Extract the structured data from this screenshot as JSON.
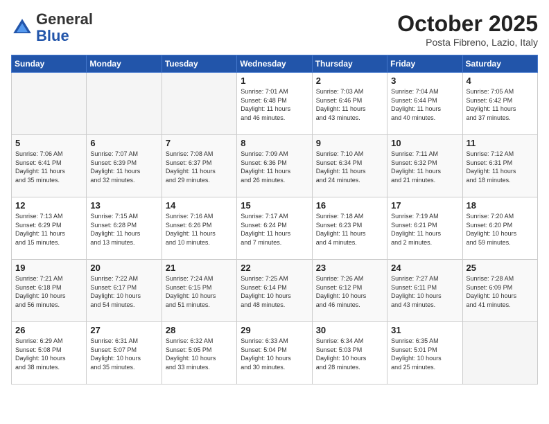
{
  "header": {
    "logo_general": "General",
    "logo_blue": "Blue",
    "month_title": "October 2025",
    "location": "Posta Fibreno, Lazio, Italy"
  },
  "weekdays": [
    "Sunday",
    "Monday",
    "Tuesday",
    "Wednesday",
    "Thursday",
    "Friday",
    "Saturday"
  ],
  "weeks": [
    [
      {
        "num": "",
        "info": "",
        "empty": true
      },
      {
        "num": "",
        "info": "",
        "empty": true
      },
      {
        "num": "",
        "info": "",
        "empty": true
      },
      {
        "num": "1",
        "info": "Sunrise: 7:01 AM\nSunset: 6:48 PM\nDaylight: 11 hours\nand 46 minutes."
      },
      {
        "num": "2",
        "info": "Sunrise: 7:03 AM\nSunset: 6:46 PM\nDaylight: 11 hours\nand 43 minutes."
      },
      {
        "num": "3",
        "info": "Sunrise: 7:04 AM\nSunset: 6:44 PM\nDaylight: 11 hours\nand 40 minutes."
      },
      {
        "num": "4",
        "info": "Sunrise: 7:05 AM\nSunset: 6:42 PM\nDaylight: 11 hours\nand 37 minutes."
      }
    ],
    [
      {
        "num": "5",
        "info": "Sunrise: 7:06 AM\nSunset: 6:41 PM\nDaylight: 11 hours\nand 35 minutes."
      },
      {
        "num": "6",
        "info": "Sunrise: 7:07 AM\nSunset: 6:39 PM\nDaylight: 11 hours\nand 32 minutes."
      },
      {
        "num": "7",
        "info": "Sunrise: 7:08 AM\nSunset: 6:37 PM\nDaylight: 11 hours\nand 29 minutes."
      },
      {
        "num": "8",
        "info": "Sunrise: 7:09 AM\nSunset: 6:36 PM\nDaylight: 11 hours\nand 26 minutes."
      },
      {
        "num": "9",
        "info": "Sunrise: 7:10 AM\nSunset: 6:34 PM\nDaylight: 11 hours\nand 24 minutes."
      },
      {
        "num": "10",
        "info": "Sunrise: 7:11 AM\nSunset: 6:32 PM\nDaylight: 11 hours\nand 21 minutes."
      },
      {
        "num": "11",
        "info": "Sunrise: 7:12 AM\nSunset: 6:31 PM\nDaylight: 11 hours\nand 18 minutes."
      }
    ],
    [
      {
        "num": "12",
        "info": "Sunrise: 7:13 AM\nSunset: 6:29 PM\nDaylight: 11 hours\nand 15 minutes."
      },
      {
        "num": "13",
        "info": "Sunrise: 7:15 AM\nSunset: 6:28 PM\nDaylight: 11 hours\nand 13 minutes."
      },
      {
        "num": "14",
        "info": "Sunrise: 7:16 AM\nSunset: 6:26 PM\nDaylight: 11 hours\nand 10 minutes."
      },
      {
        "num": "15",
        "info": "Sunrise: 7:17 AM\nSunset: 6:24 PM\nDaylight: 11 hours\nand 7 minutes."
      },
      {
        "num": "16",
        "info": "Sunrise: 7:18 AM\nSunset: 6:23 PM\nDaylight: 11 hours\nand 4 minutes."
      },
      {
        "num": "17",
        "info": "Sunrise: 7:19 AM\nSunset: 6:21 PM\nDaylight: 11 hours\nand 2 minutes."
      },
      {
        "num": "18",
        "info": "Sunrise: 7:20 AM\nSunset: 6:20 PM\nDaylight: 10 hours\nand 59 minutes."
      }
    ],
    [
      {
        "num": "19",
        "info": "Sunrise: 7:21 AM\nSunset: 6:18 PM\nDaylight: 10 hours\nand 56 minutes."
      },
      {
        "num": "20",
        "info": "Sunrise: 7:22 AM\nSunset: 6:17 PM\nDaylight: 10 hours\nand 54 minutes."
      },
      {
        "num": "21",
        "info": "Sunrise: 7:24 AM\nSunset: 6:15 PM\nDaylight: 10 hours\nand 51 minutes."
      },
      {
        "num": "22",
        "info": "Sunrise: 7:25 AM\nSunset: 6:14 PM\nDaylight: 10 hours\nand 48 minutes."
      },
      {
        "num": "23",
        "info": "Sunrise: 7:26 AM\nSunset: 6:12 PM\nDaylight: 10 hours\nand 46 minutes."
      },
      {
        "num": "24",
        "info": "Sunrise: 7:27 AM\nSunset: 6:11 PM\nDaylight: 10 hours\nand 43 minutes."
      },
      {
        "num": "25",
        "info": "Sunrise: 7:28 AM\nSunset: 6:09 PM\nDaylight: 10 hours\nand 41 minutes."
      }
    ],
    [
      {
        "num": "26",
        "info": "Sunrise: 6:29 AM\nSunset: 5:08 PM\nDaylight: 10 hours\nand 38 minutes."
      },
      {
        "num": "27",
        "info": "Sunrise: 6:31 AM\nSunset: 5:07 PM\nDaylight: 10 hours\nand 35 minutes."
      },
      {
        "num": "28",
        "info": "Sunrise: 6:32 AM\nSunset: 5:05 PM\nDaylight: 10 hours\nand 33 minutes."
      },
      {
        "num": "29",
        "info": "Sunrise: 6:33 AM\nSunset: 5:04 PM\nDaylight: 10 hours\nand 30 minutes."
      },
      {
        "num": "30",
        "info": "Sunrise: 6:34 AM\nSunset: 5:03 PM\nDaylight: 10 hours\nand 28 minutes."
      },
      {
        "num": "31",
        "info": "Sunrise: 6:35 AM\nSunset: 5:01 PM\nDaylight: 10 hours\nand 25 minutes."
      },
      {
        "num": "",
        "info": "",
        "empty": true
      }
    ]
  ]
}
